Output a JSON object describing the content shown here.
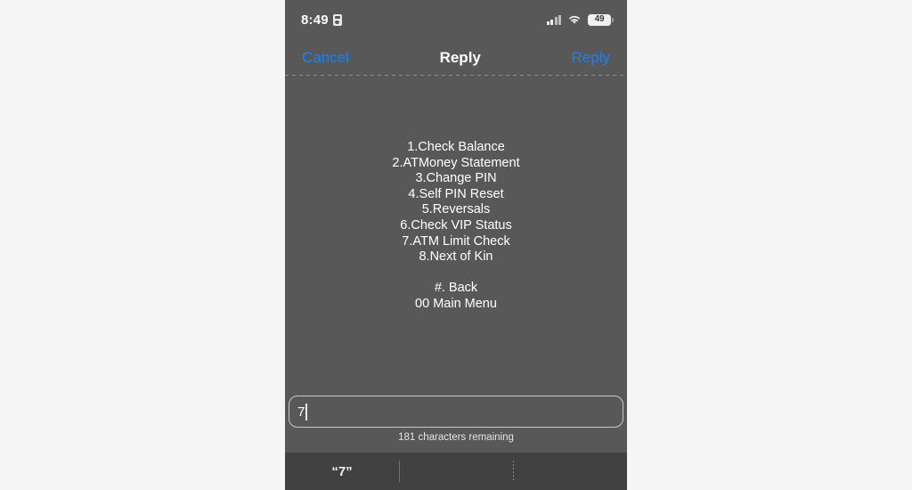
{
  "status_bar": {
    "time": "8:49",
    "sim_icon": "sim-card-icon",
    "cellular_icon": "cellular-signal-icon",
    "cellular_bars_active": 2,
    "cellular_bars_total": 4,
    "wifi_icon": "wifi-icon",
    "battery_icon": "battery-icon",
    "battery_level": "49"
  },
  "nav_bar": {
    "cancel_label": "Cancel",
    "title": "Reply",
    "reply_label": "Reply"
  },
  "message": {
    "lines": [
      "1.Check Balance",
      "2.ATMoney Statement",
      "3.Change PIN",
      "4.Self PIN Reset",
      "5.Reversals",
      "6.Check VIP Status",
      "7.ATM Limit Check",
      "8.Next of Kin",
      "",
      "#. Back",
      "00 Main Menu"
    ]
  },
  "reply_input": {
    "value": "7",
    "placeholder": "",
    "character_counter": "181 characters remaining"
  },
  "suggestion_bar": {
    "items": [
      {
        "label": "“7”"
      },
      {
        "label": ""
      },
      {
        "label": ""
      }
    ]
  },
  "colors": {
    "page_background": "#f5f5f5",
    "screen_background": "#585858",
    "suggestion_background": "#414141",
    "accent_blue": "#1a82f5",
    "text_primary": "#ffffff",
    "input_border": "#c9c9c9"
  }
}
